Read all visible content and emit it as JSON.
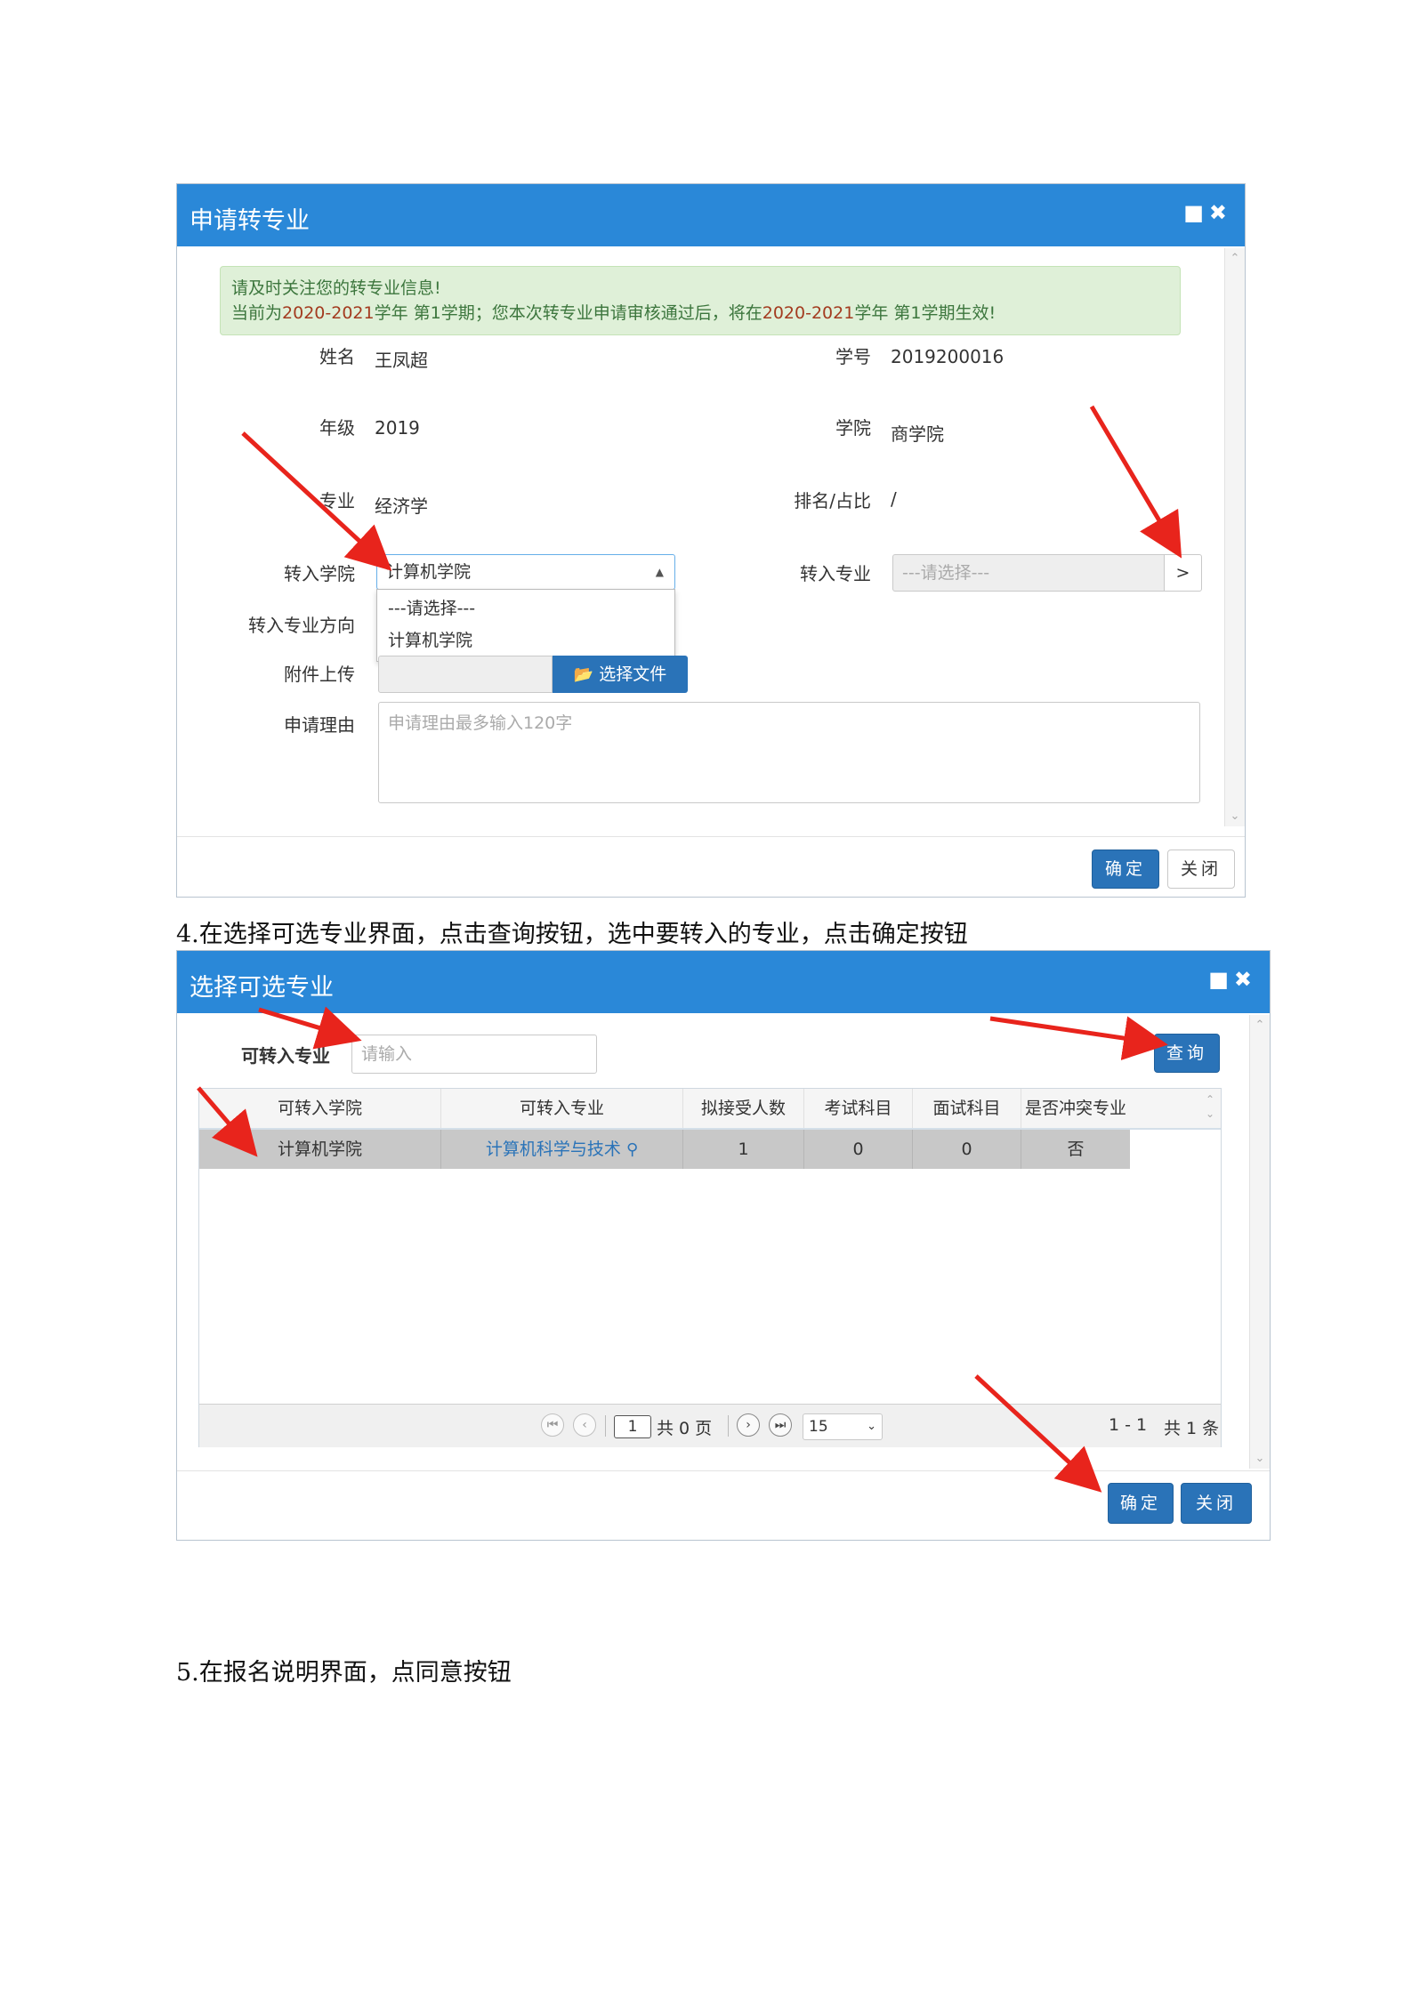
{
  "dialog1": {
    "title": "申请转专业",
    "window_icons": "■✖",
    "alert": {
      "line1": "请及时关注您的转专业信息!",
      "line2_prefix": "当前为",
      "line2_term1": "2020-2021",
      "line2_mid1": "学年 第1学期；您本次转专业申请审核通过后，将在",
      "line2_term2": "2020-2021",
      "line2_suffix": "学年 第1学期生效!"
    },
    "fields": {
      "name_label": "姓名",
      "name_value": "王凤超",
      "student_id_label": "学号",
      "student_id_value": "2019200016",
      "grade_label": "年级",
      "grade_value": "2019",
      "college_label": "学院",
      "college_value": "商学院",
      "major_label": "专业",
      "major_value": "经济学",
      "rank_label": "排名/占比",
      "rank_value": "/",
      "transfer_college_label": "转入学院",
      "transfer_college_value": "计算机学院",
      "transfer_major_label": "转入专业",
      "transfer_major_placeholder": "---请选择---",
      "transfer_major_btn": ">",
      "direction_label": "转入专业方向",
      "attachment_label": "附件上传",
      "choose_file_label": "选择文件",
      "reason_label": "申请理由",
      "reason_placeholder": "申请理由最多输入120字"
    },
    "dropdown_options": [
      "---请选择---",
      "计算机学院"
    ],
    "confirm_label": "确定",
    "close_label": "关闭"
  },
  "caption4": "4.在选择可选专业界面，点击查询按钮，选中要转入的专业，点击确定按钮",
  "dialog2": {
    "title": "选择可选专业",
    "window_icons": "■✖",
    "search_label": "可转入专业",
    "search_placeholder": "请输入",
    "query_label": "查询",
    "columns": [
      "可转入学院",
      "可转入专业",
      "拟接受人数",
      "考试科目",
      "面试科目",
      "是否冲突专业"
    ],
    "rows": [
      {
        "college": "计算机学院",
        "major": "计算机科学与技术",
        "quota": "1",
        "exam": "0",
        "interview": "0",
        "conflict": "否"
      }
    ],
    "pager": {
      "page_value": "1",
      "total_pages_text": "共 0 页",
      "page_size": "15",
      "range_text": "1 - 1",
      "total_text": "共 1 条"
    },
    "confirm_label": "确定",
    "close_label": "关闭"
  },
  "caption5": "5.在报名说明界面，点同意按钮",
  "colors": {
    "titlebar": "#2a88d8",
    "primary_button": "#2a73b8",
    "alert_bg": "#dff0d8",
    "alert_text": "#3c763d",
    "arrow": "#e8241c"
  }
}
